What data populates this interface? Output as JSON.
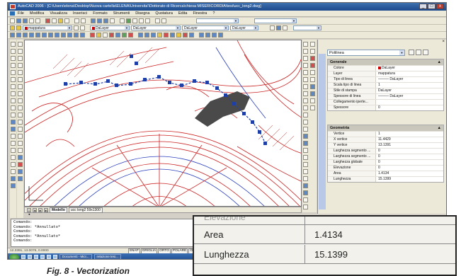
{
  "window": {
    "title": "AutoCAD 2006 - [C:\\Users\\elena\\Desktop\\Nuova cartella\\ELENA\\Universita'\\Dottorato di Ricerca\\chiesa MISERICORDIA\\tesi\\ucc_long2.dwg]",
    "controls": [
      "_",
      "□",
      "x"
    ]
  },
  "menu": [
    "File",
    "Modifica",
    "Visualizza",
    "Inserisci",
    "Formato",
    "Strumenti",
    "Disegna",
    "Quotatura",
    "Edita",
    "Finestra",
    "?"
  ],
  "toolbar": {
    "layer_combo": "mappatura",
    "color_combo": "DaLayer",
    "linetype_combo": "DaLayer",
    "lineweight_combo": "DaLayer",
    "plotstyle_combo": "DaLayer"
  },
  "layout_tabs": [
    "Modello",
    "ucc long2 59x1300"
  ],
  "layout_nav": [
    "|◄",
    "◄",
    "►",
    "►|"
  ],
  "properties": {
    "object_type": "Polilinea",
    "close_glyph": "×",
    "sections": [
      {
        "title": "Generale",
        "toggle": "▲",
        "rows": [
          {
            "key": "Colore",
            "value": "DaLayer",
            "swatch": "#cc0000"
          },
          {
            "key": "Layer",
            "value": "mappatura"
          },
          {
            "key": "Tipo di linea",
            "value": "——— DaLayer"
          },
          {
            "key": "Scala tipo di linea",
            "value": "1"
          },
          {
            "key": "Stile di stampa",
            "value": "DaLayer"
          },
          {
            "key": "Spessore di linea",
            "value": "——— DaLayer"
          },
          {
            "key": "Collegamento iperte...",
            "value": ""
          },
          {
            "key": "Spessore",
            "value": "0"
          }
        ]
      },
      {
        "title": "Geometria",
        "toggle": "▲",
        "rows": [
          {
            "key": "Vertice",
            "value": "1"
          },
          {
            "key": "X vertice",
            "value": "11.4429"
          },
          {
            "key": "Y vertice",
            "value": "13.1391"
          },
          {
            "key": "Larghezza segmento ...",
            "value": "0"
          },
          {
            "key": "Larghezza segmento ...",
            "value": "0"
          },
          {
            "key": "Larghezza globale",
            "value": "0"
          },
          {
            "key": "Elevazione",
            "value": "0"
          },
          {
            "key": "Area",
            "value": "1.4134"
          },
          {
            "key": "Lunghezza",
            "value": "15.1399"
          }
        ]
      }
    ]
  },
  "command_line": [
    "Comando:",
    "Comando:  *Annullato*",
    "Comando:",
    "Comando:  *Annullato*",
    "Comando:"
  ],
  "status": {
    "coords": "12.3391, 13.0076, 0.0000",
    "buttons": [
      "SNAP",
      "GRIGLIA",
      "ORTO",
      "POLARE",
      "OSNAP",
      "OPUNTAMENTO"
    ]
  },
  "taskbar": {
    "tasks": [
      "Documenti - Micr...",
      "relazione tesi..."
    ]
  },
  "zoom_inset": {
    "ghost_label": "Elevazione",
    "rows": [
      {
        "key": "Area",
        "value": "1.4134"
      },
      {
        "key": "Lunghezza",
        "value": "15.1399"
      }
    ]
  },
  "caption": "Fig. 8 - Vectorization",
  "colors": {
    "selection_grips": "#1f3fa8",
    "map_fill": "#4a4a4a",
    "drawing_lines": "#cc2222",
    "drawing_blue": "#2a3fbf"
  }
}
